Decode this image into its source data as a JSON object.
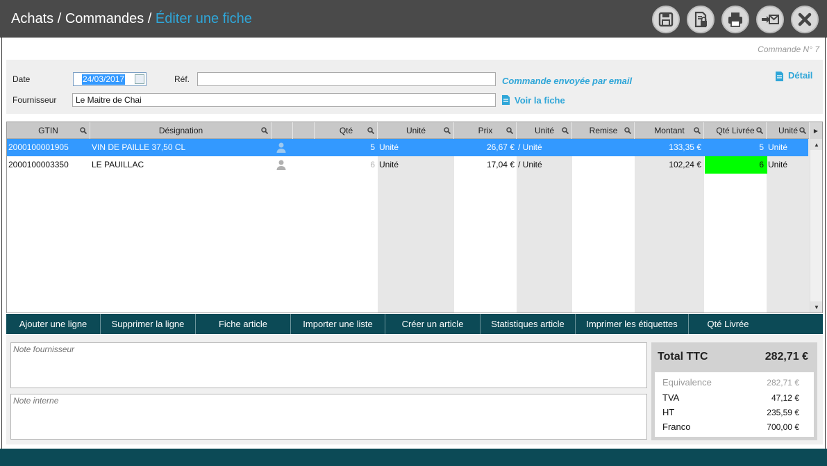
{
  "breadcrumb": {
    "part1": "Achats",
    "sep1": " / ",
    "part2": "Commandes",
    "sep2": " / ",
    "current": "Éditer une fiche"
  },
  "toolbar_icons": [
    "save-icon",
    "document-lock-icon",
    "print-icon",
    "send-email-icon",
    "close-icon"
  ],
  "order_number": "Commande N° 7",
  "form": {
    "date_label": "Date",
    "date_value": "24/03/2017",
    "ref_label": "Réf.",
    "ref_value": "",
    "email_status": "Commande envoyée par email",
    "detail_label": "Détail",
    "supplier_label": "Fournisseur",
    "supplier_value": "Le Maitre de Chai",
    "view_sheet_label": "Voir la fiche"
  },
  "grid": {
    "columns": [
      "GTIN",
      "Désignation",
      "",
      "",
      "Qté",
      "Unité",
      "Prix",
      "Unité",
      "Remise",
      "Montant",
      "Qté Livrée",
      "Unité"
    ],
    "rows": [
      {
        "gtin": "2000100001905",
        "designation": "VIN DE PAILLE  37,50 CL",
        "qty": "5",
        "unit": "Unité",
        "price": "26,67 €",
        "price_unit": "/ Unité",
        "discount": "",
        "amount": "133,35 €",
        "qty_delivered": "5",
        "delivered_unit": "Unité",
        "selected": true
      },
      {
        "gtin": "2000100003350",
        "designation": "LE PAUILLAC",
        "qty": "6",
        "unit": "Unité",
        "price": "17,04 €",
        "price_unit": "/ Unité",
        "discount": "",
        "amount": "102,24 €",
        "qty_delivered": "6",
        "delivered_unit": "Unité",
        "selected": false
      }
    ],
    "delivered_highlight_color": "#00ff00",
    "selection_color": "#3399ff"
  },
  "actions": [
    "Ajouter une ligne",
    "Supprimer la ligne",
    "Fiche article",
    "Importer une liste",
    "Créer un article",
    "Statistiques article",
    "Imprimer les étiquettes",
    "Qté Livrée"
  ],
  "notes": {
    "supplier_placeholder": "Note fournisseur",
    "internal_placeholder": "Note interne"
  },
  "totals": {
    "title": "Total TTC",
    "value": "282,71 €",
    "lines": [
      {
        "label": "Equivalence",
        "value": "282,71 €"
      },
      {
        "label": "TVA",
        "value": "47,12 €"
      },
      {
        "label": "HT",
        "value": "235,59 €"
      },
      {
        "label": "Franco",
        "value": "700,00 €"
      }
    ]
  },
  "colors": {
    "accent": "#2fa6d8",
    "bar": "#0c4a56",
    "header": "#4a4a4a"
  }
}
